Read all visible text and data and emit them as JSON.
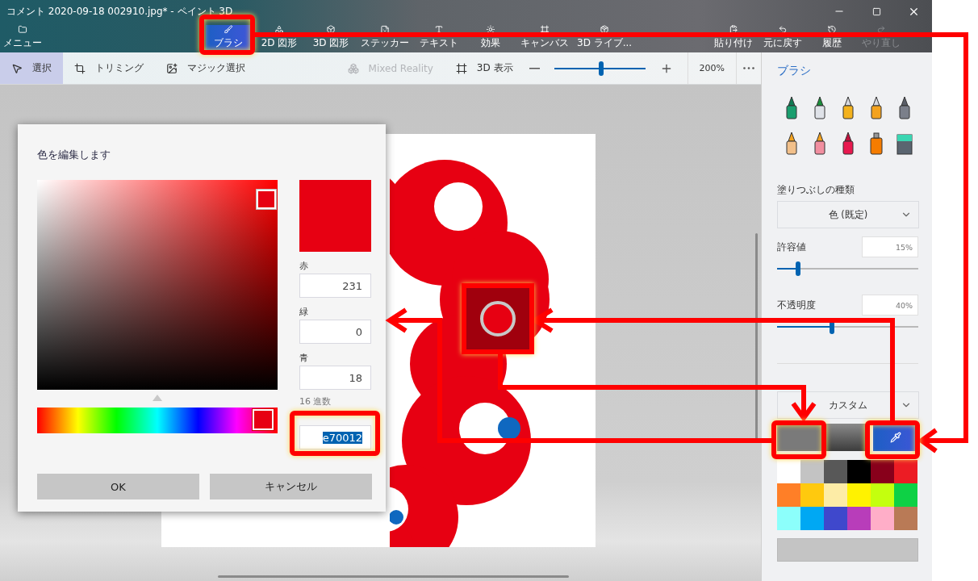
{
  "window": {
    "title": "コメント 2020-09-18 002910.jpg* - ペイント 3D"
  },
  "menu_button": {
    "label": "メニュー"
  },
  "ribbon_tabs": [
    {
      "label": "ブラシ",
      "selected": true
    },
    {
      "label": "2D 図形",
      "selected": false
    },
    {
      "label": "3D 図形",
      "selected": false
    },
    {
      "label": "ステッカー",
      "selected": false
    },
    {
      "label": "テキスト",
      "selected": false
    },
    {
      "label": "効果",
      "selected": false
    },
    {
      "label": "キャンバス",
      "selected": false
    },
    {
      "label": "3D ライブ...",
      "selected": false
    }
  ],
  "ribbon_commands": [
    {
      "label": "貼り付け",
      "disabled": false
    },
    {
      "label": "元に戻す",
      "disabled": false
    },
    {
      "label": "履歴",
      "disabled": false
    },
    {
      "label": "やり直し",
      "disabled": true
    }
  ],
  "toolbar": {
    "tools": [
      {
        "label": "選択",
        "selected": true
      },
      {
        "label": "トリミング",
        "selected": false
      },
      {
        "label": "マジック選択",
        "selected": false
      }
    ],
    "view_tools": [
      {
        "label": "Mixed Reality",
        "disabled": true
      },
      {
        "label": "3D 表示",
        "disabled": false
      }
    ],
    "zoom": {
      "level": 0.52,
      "reading": "200%"
    }
  },
  "color_dialog": {
    "title": "色を編集します",
    "preview": {
      "color": "#e70012"
    },
    "hue": {
      "level": 0.94
    },
    "channels": [
      {
        "label": "赤",
        "value": "231"
      },
      {
        "label": "緑",
        "value": "0"
      },
      {
        "label": "青",
        "value": "18"
      }
    ],
    "hex": {
      "label": "16 進数",
      "value": "e70012",
      "value_selected": true
    },
    "buttons": [
      "OK",
      "キャンセル"
    ]
  },
  "panel": {
    "title": "ブラシ",
    "fill_type": {
      "label": "塗りつぶしの種類",
      "value": "色 (既定)"
    },
    "sliders": [
      {
        "label": "許容値",
        "reading": "15%",
        "level": 0.15
      },
      {
        "label": "不透明度",
        "reading": "40%",
        "level": 0.39
      }
    ],
    "color_mode": {
      "value": "カスタム"
    },
    "color_slots": [
      {
        "kind": "swatch"
      },
      {
        "kind": "gradient"
      },
      {
        "kind": "eyedropper"
      }
    ],
    "palette": [
      {
        "color": "#ffffff"
      },
      {
        "color": "#c3c3c3"
      },
      {
        "color": "#585858"
      },
      {
        "color": "#000000"
      },
      {
        "color": "#88001b"
      },
      {
        "color": "#ec1c24"
      },
      {
        "color": "#ff7f27"
      },
      {
        "color": "#ffc90e"
      },
      {
        "color": "#fdeca6"
      },
      {
        "color": "#fff200"
      },
      {
        "color": "#c4ff0e"
      },
      {
        "color": "#0ed145"
      },
      {
        "color": "#8cfffb"
      },
      {
        "color": "#00a8f3"
      },
      {
        "color": "#3f48cc"
      },
      {
        "color": "#b83dba"
      },
      {
        "color": "#ffaec8"
      },
      {
        "color": "#b97a56"
      }
    ]
  }
}
